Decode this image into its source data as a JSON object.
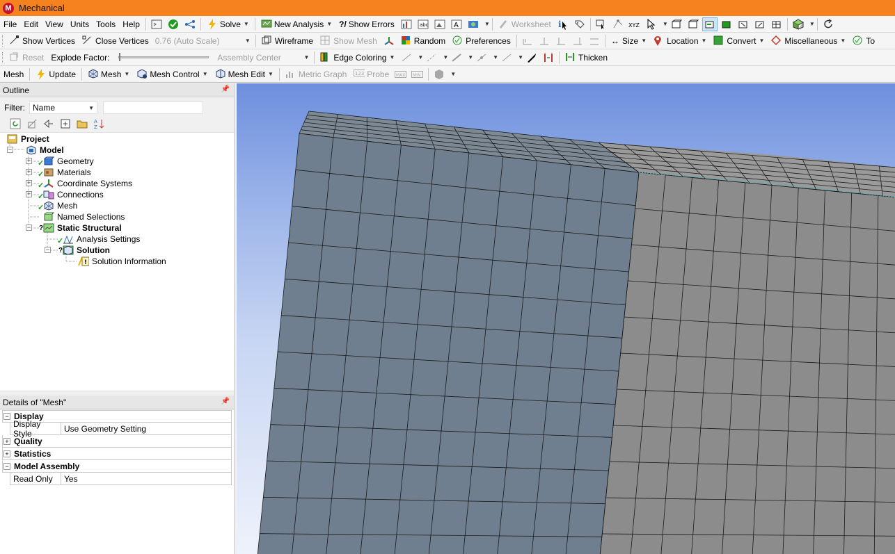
{
  "window": {
    "title": "Mechanical",
    "logo": "M"
  },
  "menubar": {
    "menus": [
      "File",
      "Edit",
      "View",
      "Units",
      "Tools",
      "Help"
    ],
    "solve_label": "Solve",
    "new_analysis_label": "New Analysis",
    "show_errors_label": "Show Errors",
    "worksheet_label": "Worksheet"
  },
  "toolbar2": {
    "show_vertices": "Show Vertices",
    "close_vertices": "Close Vertices",
    "scale_value": "0.76 (Auto Scale)",
    "wireframe": "Wireframe",
    "show_mesh": "Show Mesh",
    "random": "Random",
    "preferences": "Preferences",
    "size": "Size",
    "location": "Location",
    "convert": "Convert",
    "miscellaneous": "Miscellaneous",
    "to": "To"
  },
  "toolbar3": {
    "reset": "Reset",
    "explode_factor": "Explode Factor:",
    "assembly_center": "Assembly Center",
    "edge_coloring": "Edge Coloring",
    "thicken": "Thicken"
  },
  "toolbar4": {
    "mesh": "Mesh",
    "update": "Update",
    "mesh_menu": "Mesh",
    "mesh_control": "Mesh Control",
    "mesh_edit": "Mesh Edit",
    "metric_graph": "Metric Graph",
    "probe": "Probe",
    "max_label": "MAX",
    "min_label": "MIN"
  },
  "outline": {
    "title": "Outline",
    "filter_label": "Filter:",
    "filter_value": "Name",
    "tree": [
      {
        "label": "Project",
        "bold": true
      },
      {
        "label": "Model",
        "bold": true
      },
      {
        "label": "Geometry"
      },
      {
        "label": "Materials"
      },
      {
        "label": "Coordinate Systems"
      },
      {
        "label": "Connections"
      },
      {
        "label": "Mesh"
      },
      {
        "label": "Named Selections"
      },
      {
        "label": "Static Structural",
        "bold": true
      },
      {
        "label": "Analysis Settings"
      },
      {
        "label": "Solution",
        "bold": true
      },
      {
        "label": "Solution Information"
      }
    ]
  },
  "details": {
    "title": "Details of \"Mesh\"",
    "groups": {
      "display": "Display",
      "quality": "Quality",
      "statistics": "Statistics",
      "model_assembly": "Model Assembly"
    },
    "rows": {
      "display_style_key": "Display Style",
      "display_style_value": "Use Geometry Setting",
      "read_only_key": "Read Only",
      "read_only_value": "Yes"
    }
  },
  "colors": {
    "titlebar": "#f5821f",
    "left_body": "#6f7f8f",
    "right_body": "#8c8c8c",
    "mesh_lines": "#1a1a1a",
    "viewport_top": "#6d8fdd"
  }
}
